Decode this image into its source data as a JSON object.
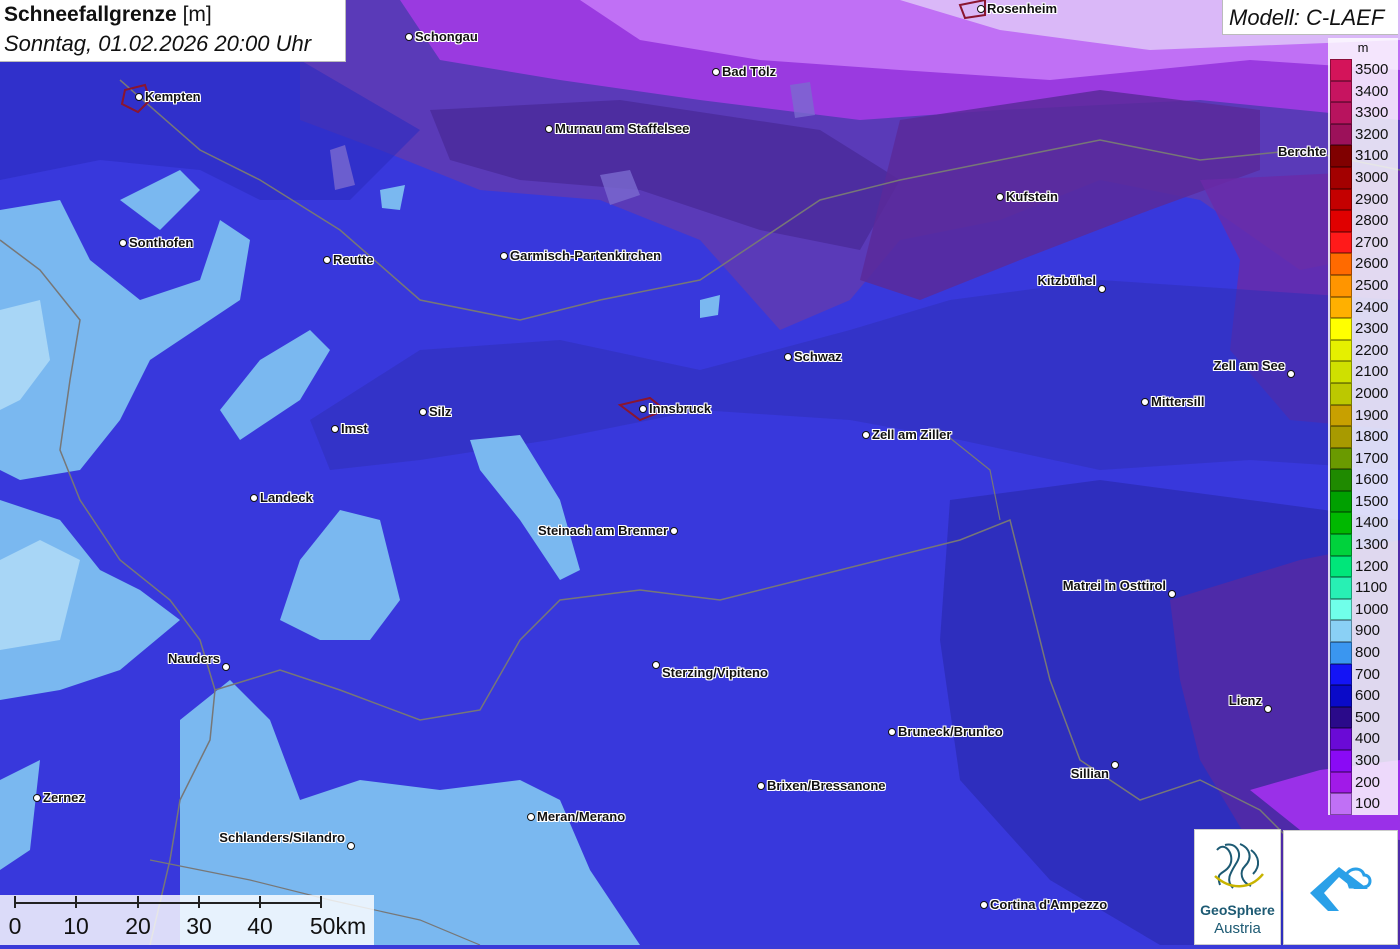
{
  "title": {
    "main": "Schneefallgrenze",
    "unit": "[m]",
    "date": "Sonntag, 01.02.2026 20:00 Uhr"
  },
  "model": {
    "label": "Modell: C-LAEF"
  },
  "legend": {
    "unit": "m",
    "entries": [
      {
        "value": "3500",
        "color": "#d4145a"
      },
      {
        "value": "3400",
        "color": "#c71460"
      },
      {
        "value": "3300",
        "color": "#b8135e"
      },
      {
        "value": "3200",
        "color": "#9c115a"
      },
      {
        "value": "3100",
        "color": "#800000"
      },
      {
        "value": "3000",
        "color": "#a30000"
      },
      {
        "value": "2900",
        "color": "#c40000"
      },
      {
        "value": "2800",
        "color": "#e00000"
      },
      {
        "value": "2700",
        "color": "#ff1a1a"
      },
      {
        "value": "2600",
        "color": "#ff6a00"
      },
      {
        "value": "2500",
        "color": "#ff9500"
      },
      {
        "value": "2400",
        "color": "#ffb000"
      },
      {
        "value": "2300",
        "color": "#ffff00"
      },
      {
        "value": "2200",
        "color": "#e5f000"
      },
      {
        "value": "2100",
        "color": "#cfe000"
      },
      {
        "value": "2000",
        "color": "#bcc800"
      },
      {
        "value": "1900",
        "color": "#c8a000"
      },
      {
        "value": "1800",
        "color": "#a89a00"
      },
      {
        "value": "1700",
        "color": "#6a9a00"
      },
      {
        "value": "1600",
        "color": "#1f8a00"
      },
      {
        "value": "1500",
        "color": "#00a000"
      },
      {
        "value": "1400",
        "color": "#00b800"
      },
      {
        "value": "1300",
        "color": "#00d23c"
      },
      {
        "value": "1200",
        "color": "#00e67a"
      },
      {
        "value": "1100",
        "color": "#28f0b4"
      },
      {
        "value": "1000",
        "color": "#70ffea"
      },
      {
        "value": "900",
        "color": "#8ad0f5"
      },
      {
        "value": "800",
        "color": "#3a96f0"
      },
      {
        "value": "700",
        "color": "#1414f5"
      },
      {
        "value": "600",
        "color": "#0a0ac8"
      },
      {
        "value": "500",
        "color": "#2a0a8a"
      },
      {
        "value": "400",
        "color": "#6a0ad6"
      },
      {
        "value": "300",
        "color": "#8a0af5"
      },
      {
        "value": "200",
        "color": "#a11ae8"
      },
      {
        "value": "100",
        "color": "#c070f5"
      }
    ]
  },
  "cities": [
    {
      "name": "Rosenheim"
    },
    {
      "name": "Schongau"
    },
    {
      "name": "Bad Tölz"
    },
    {
      "name": "Kempten"
    },
    {
      "name": "Murnau am Staffelsee"
    },
    {
      "name": "Berchte"
    },
    {
      "name": "Kufstein"
    },
    {
      "name": "Sonthofen"
    },
    {
      "name": "Reutte"
    },
    {
      "name": "Garmisch-Partenkirchen"
    },
    {
      "name": "Kitzbühel"
    },
    {
      "name": "Schwaz"
    },
    {
      "name": "Zell am See"
    },
    {
      "name": "Mittersill"
    },
    {
      "name": "Innsbruck"
    },
    {
      "name": "Silz"
    },
    {
      "name": "Imst"
    },
    {
      "name": "Zell am Ziller"
    },
    {
      "name": "Landeck"
    },
    {
      "name": "Steinach am Brenner"
    },
    {
      "name": "Matrei in Osttirol"
    },
    {
      "name": "Nauders"
    },
    {
      "name": "Sterzing/Vipiteno"
    },
    {
      "name": "Lienz"
    },
    {
      "name": "Bruneck/Brunico"
    },
    {
      "name": "Sillian"
    },
    {
      "name": "Brixen/Bressanone"
    },
    {
      "name": "Zernez"
    },
    {
      "name": "Meran/Merano"
    },
    {
      "name": "Schlanders/Silandro"
    },
    {
      "name": "Cortina d'Ampezzo"
    }
  ],
  "scalebar": {
    "labels": [
      "0",
      "10",
      "20",
      "30",
      "40",
      "50km"
    ]
  },
  "logo": {
    "name": "GeoSphere",
    "sub": "Austria"
  }
}
